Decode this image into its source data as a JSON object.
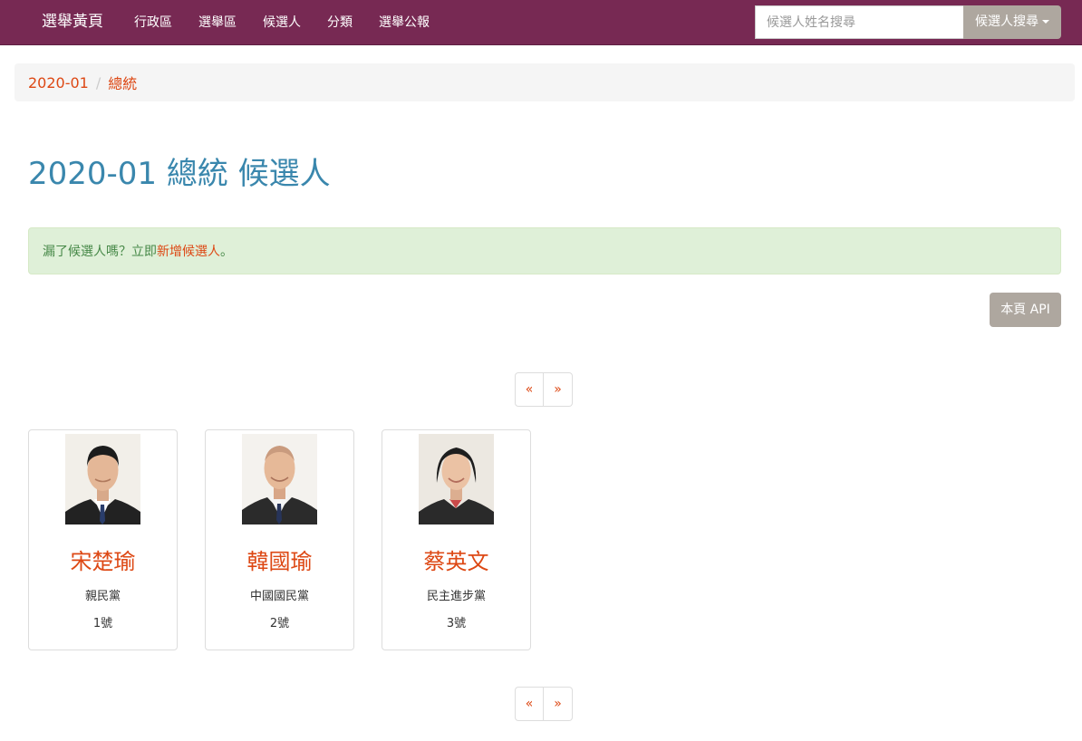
{
  "navbar": {
    "brand": "選舉黃頁",
    "links": [
      "行政區",
      "選舉區",
      "候選人",
      "分類",
      "選舉公報"
    ],
    "search_placeholder": "候選人姓名搜尋",
    "search_button": "候選人搜尋"
  },
  "breadcrumb": [
    "2020-01",
    "總統"
  ],
  "page_title": "2020-01 總統 候選人",
  "alert": {
    "text": "漏了候選人嗎？立即",
    "link": "新增候選人",
    "suffix": "。"
  },
  "api_button": "本頁 API",
  "pager": {
    "prev": "«",
    "next": "»"
  },
  "candidates": [
    {
      "name": "宋楚瑜",
      "party": "親民黨",
      "number": "1號"
    },
    {
      "name": "韓國瑜",
      "party": "中國國民黨",
      "number": "2號"
    },
    {
      "name": "蔡英文",
      "party": "民主進步黨",
      "number": "3號"
    }
  ],
  "colors": {
    "navbar": "#772953",
    "accent": "#dd4814",
    "title": "#3a87ad",
    "alert_bg": "#dff0d8",
    "button": "#aea79f"
  }
}
